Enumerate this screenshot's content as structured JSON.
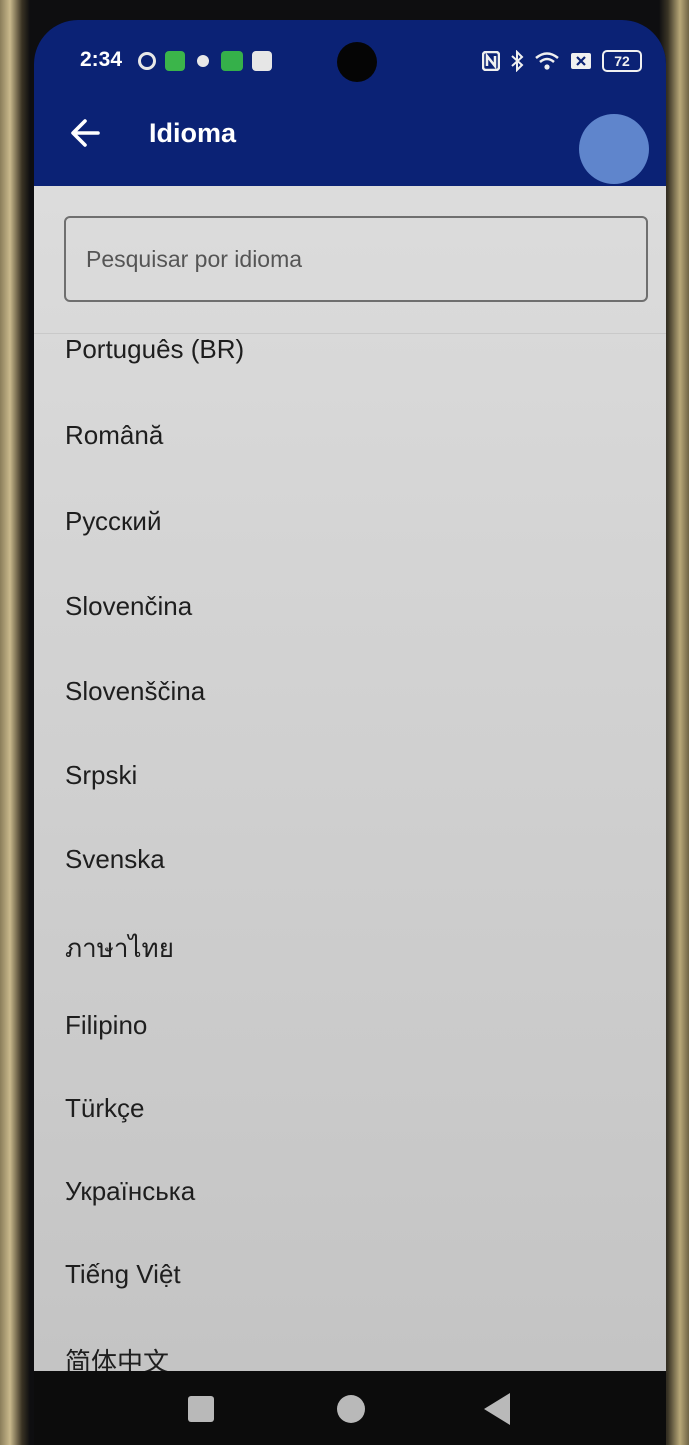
{
  "status_bar": {
    "time": "2:34",
    "battery": "72"
  },
  "app_bar": {
    "title": "Idioma"
  },
  "search": {
    "placeholder": "Pesquisar por idioma",
    "value": ""
  },
  "languages": [
    "Português (BR)",
    "Română",
    "Русский",
    "Slovenčina",
    "Slovenščina",
    "Srpski",
    "Svenska",
    "ภาษาไทย",
    "Filipino",
    "Türkçe",
    "Українська",
    "Tiếng Việt",
    "简体中文"
  ],
  "colors": {
    "app_bar": "#0b2275",
    "content_bg": "#d6d6d6",
    "text": "#1e1e1e"
  },
  "icons": {
    "back": "arrow-left-icon",
    "nav_recents": "square-icon",
    "nav_home": "circle-icon",
    "nav_back": "triangle-back-icon"
  }
}
